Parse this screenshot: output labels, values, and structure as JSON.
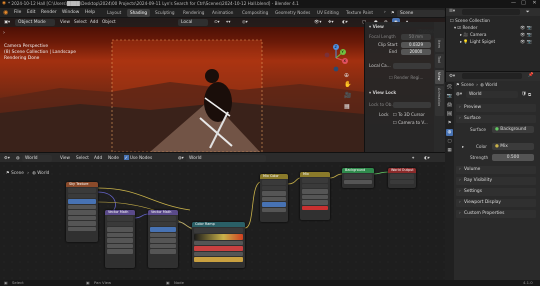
{
  "title_bar": {
    "title": "* 2024-10-12 Hall [C:\\Users\\████\\Desktop\\2024\\00 Projects\\2024-09-11 Lyn's Search for Ctrl\\Scenes\\2024-10-12 Hall.blend] - Blender 4.1",
    "controls": [
      "—",
      "□",
      "✕"
    ]
  },
  "menu": {
    "items": [
      "File",
      "Edit",
      "Render",
      "Window",
      "Help"
    ]
  },
  "workspaces": {
    "tabs": [
      "Layout",
      "Shading",
      "Sculpting",
      "Rendering",
      "Animation",
      "Compositing",
      "Geometry Nodes",
      "UV Editing",
      "Texture Paint"
    ],
    "active": "Shading"
  },
  "scene_selector": {
    "scene": "Scene",
    "view_layer": "ViewLayer"
  },
  "viewport": {
    "mode": "Object Mode",
    "menus": [
      "View",
      "Select",
      "Add",
      "Object"
    ],
    "transform": "Local",
    "options_label": "Options",
    "overlay_lines": [
      "Camera Perspective",
      "(8) Scene Collection | Landscape",
      "Rendering Done"
    ],
    "gizmo": {
      "x": "X",
      "y": "Y",
      "z": "Z"
    }
  },
  "npanel": {
    "view_header": "View",
    "focal_length_label": "Focal Length",
    "focal_length_value": "50 mm",
    "clip_start_label": "Clip Start",
    "clip_start_value": "0.0329",
    "clip_end_label": "End",
    "clip_end_value": "20000",
    "local_camera_label": "Local Ca...",
    "render_region_label": "Render Regi...",
    "view_lock_header": "View Lock",
    "lock_to_object_label": "Lock to Ob...",
    "lock_label": "Lock",
    "to_3d_cursor": "To 3D Cursor",
    "camera_to_view": "Camera to V...",
    "tabs": [
      "Item",
      "Tool",
      "View",
      "Animation"
    ]
  },
  "node_editor": {
    "type": "World",
    "menus": [
      "View",
      "Select",
      "Add",
      "Node"
    ],
    "use_nodes_label": "Use Nodes",
    "datablock": "World",
    "breadcrumb": [
      "Scene",
      "World"
    ],
    "node_titles": [
      "Sky Texture",
      "Vector Math",
      "Vector Math",
      "Color Ramp",
      "Mix Color",
      "Mix",
      "Background",
      "World Output"
    ]
  },
  "outliner": {
    "title": "Scene Collection",
    "items": [
      "Scene Collection",
      "Render",
      "Camera",
      "Light Spiget"
    ]
  },
  "properties": {
    "breadcrumb": [
      "Scene",
      "World"
    ],
    "world_name": "World",
    "sections": [
      "Preview",
      "Surface",
      "Volume",
      "Ray Visibility",
      "Settings",
      "Viewport Display",
      "Custom Properties"
    ],
    "surface_label": "Surface",
    "surface_value": "Background",
    "color_label": "Color",
    "color_value": "Mix",
    "strength_label": "Strength",
    "strength_value": "0.500"
  },
  "status_bar": {
    "select": "Select",
    "pan": "Pan View",
    "node": "Node",
    "version": "4.1.0"
  },
  "colors": {
    "accent": "#4772b3",
    "sky_node": "#8a4a2a",
    "vector_node": "#5a4a8a",
    "converter_node": "#2a5f66",
    "shader_node": "#2f8a4c",
    "output_node": "#8a2a2a"
  }
}
